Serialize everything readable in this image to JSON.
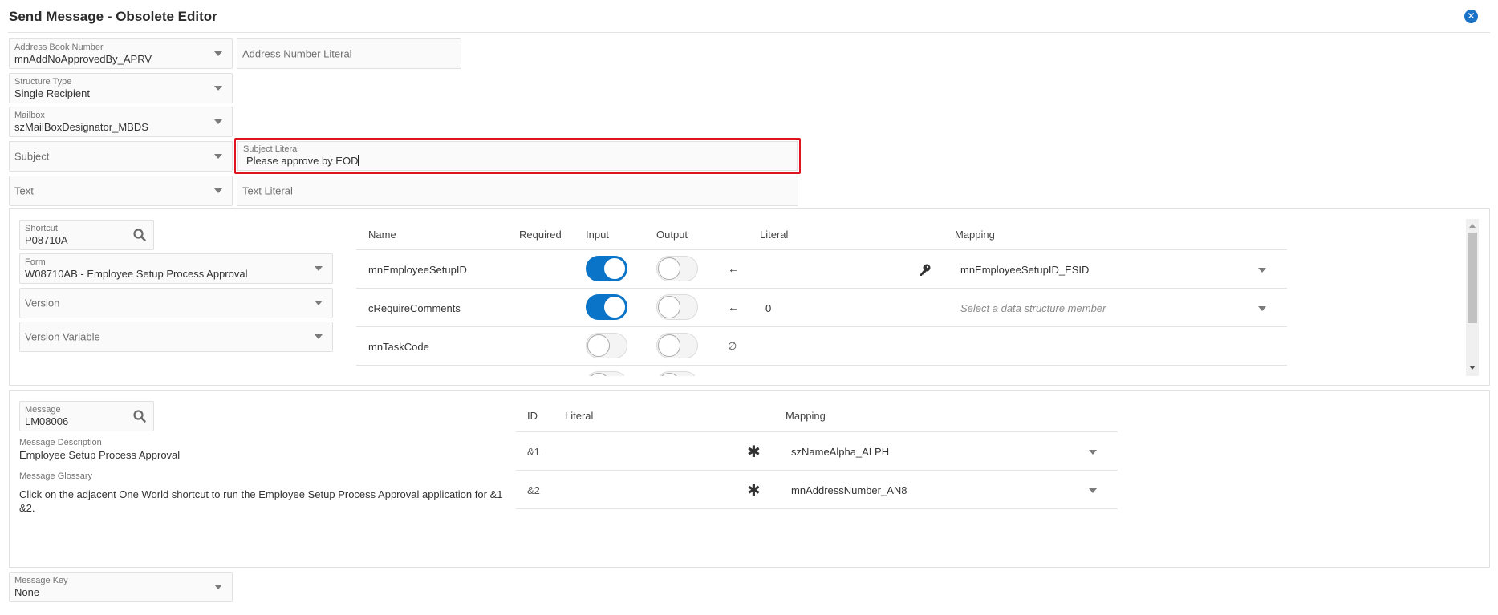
{
  "window": {
    "title": "Send Message - Obsolete Editor",
    "close_icon": "close-circle-icon"
  },
  "top_fields": {
    "address_book_number": {
      "label": "Address Book Number",
      "value": "mnAddNoApprovedBy_APRV"
    },
    "address_number_literal": {
      "placeholder": "Address Number Literal"
    },
    "structure_type": {
      "label": "Structure Type",
      "value": "Single Recipient"
    },
    "mailbox": {
      "label": "Mailbox",
      "value": "szMailBoxDesignator_MBDS"
    },
    "subject": {
      "placeholder": "Subject"
    },
    "subject_literal": {
      "label": "Subject Literal",
      "value": "Please approve by EOD"
    },
    "text": {
      "placeholder": "Text"
    },
    "text_literal": {
      "placeholder": "Text Literal"
    }
  },
  "shortcut_panel": {
    "shortcut": {
      "label": "Shortcut",
      "value": "P08710A"
    },
    "form": {
      "label": "Form",
      "value": "W08710AB - Employee Setup Process Approval"
    },
    "version": {
      "placeholder": "Version"
    },
    "version_variable": {
      "placeholder": "Version Variable"
    },
    "table": {
      "headers": {
        "name": "Name",
        "required": "Required",
        "input": "Input",
        "output": "Output",
        "literal": "Literal",
        "mapping": "Mapping"
      },
      "rows": [
        {
          "name": "mnEmployeeSetupID",
          "required": "",
          "input": true,
          "output": false,
          "direction": "←",
          "literal": "",
          "key": true,
          "mapping": "mnEmployeeSetupID_ESID",
          "mapping_placeholder": false
        },
        {
          "name": "cRequireComments",
          "required": "",
          "input": true,
          "output": false,
          "direction": "←",
          "literal": "0",
          "key": false,
          "mapping": "Select a data structure member",
          "mapping_placeholder": true
        },
        {
          "name": "mnTaskCode",
          "required": "",
          "input": false,
          "output": false,
          "direction": "∅",
          "literal": "",
          "key": false,
          "mapping": "",
          "mapping_placeholder": false
        }
      ]
    }
  },
  "message_panel": {
    "message": {
      "label": "Message",
      "value": "LM08006"
    },
    "description": {
      "label": "Message Description",
      "value": "Employee Setup Process Approval"
    },
    "glossary": {
      "label": "Message Glossary",
      "value": "Click on the adjacent One World shortcut to run the Employee Setup Process Approval application for &1 &2."
    },
    "table": {
      "headers": {
        "id": "ID",
        "literal": "Literal",
        "mapping": "Mapping"
      },
      "rows": [
        {
          "id": "&1",
          "literal": "",
          "required_mark": "✱",
          "mapping": "szNameAlpha_ALPH"
        },
        {
          "id": "&2",
          "literal": "",
          "required_mark": "✱",
          "mapping": "mnAddressNumber_AN8"
        }
      ]
    }
  },
  "message_key": {
    "label": "Message Key",
    "value": "None"
  },
  "colors": {
    "accent": "#0a74c8",
    "focus_border": "#e0141e",
    "close": "#1a73c7"
  }
}
